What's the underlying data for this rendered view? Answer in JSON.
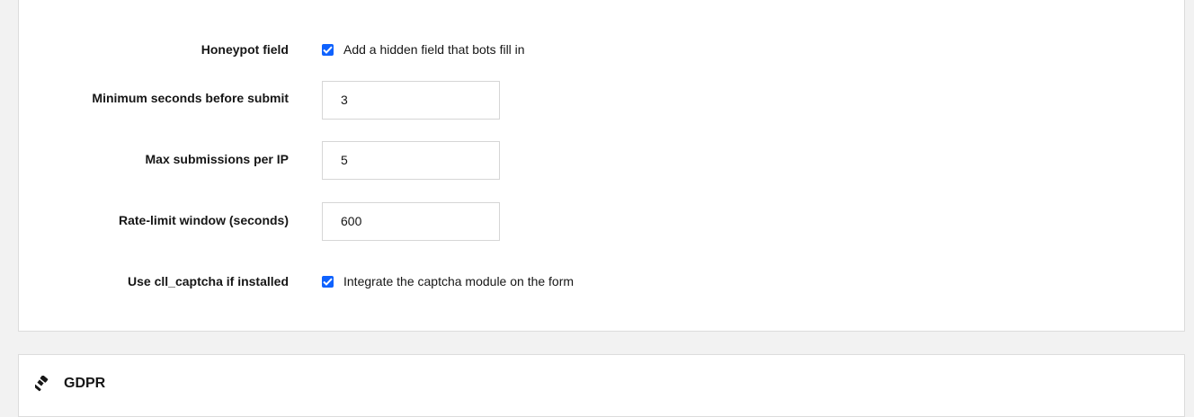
{
  "settings": {
    "honeypot": {
      "label": "Honeypot field",
      "checked": true,
      "description": "Add a hidden field that bots fill in"
    },
    "min_seconds": {
      "label": "Minimum seconds before submit",
      "value": "3"
    },
    "max_submissions": {
      "label": "Max submissions per IP",
      "value": "5"
    },
    "rate_window": {
      "label": "Rate-limit window (seconds)",
      "value": "600"
    },
    "captcha": {
      "label": "Use cll_captcha if installed",
      "checked": true,
      "description": "Integrate the captcha module on the form"
    }
  },
  "gdpr_section": {
    "title": "GDPR",
    "icon": "gavel-icon"
  },
  "colors": {
    "accent": "#0f62fe",
    "background": "#f2f2f2",
    "panel": "#ffffff",
    "border": "#dcdcdc"
  }
}
